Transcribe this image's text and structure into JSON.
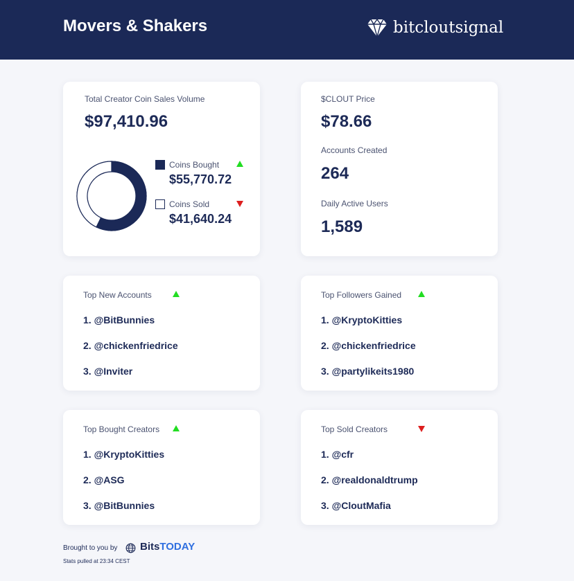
{
  "header": {
    "title": "Movers & Shakers",
    "brand_name": "bitcloutsignal",
    "brand_icon": "diamond-icon"
  },
  "sales": {
    "label": "Total Creator Coin Sales Volume",
    "total": "$97,410.96",
    "bought_label": "Coins Bought",
    "bought_value": "$55,770.72",
    "bought_trend": "up",
    "sold_label": "Coins Sold",
    "sold_value": "$41,640.24",
    "sold_trend": "down"
  },
  "chart_data": {
    "type": "pie",
    "categories": [
      "Coins Bought",
      "Coins Sold"
    ],
    "values": [
      55770.72,
      41640.24
    ],
    "colors": [
      "#1b2957",
      "#ffffff"
    ]
  },
  "stats": {
    "price_label": "$CLOUT Price",
    "price_value": "$78.66",
    "accounts_label": "Accounts Created",
    "accounts_value": "264",
    "dau_label": "Daily Active Users",
    "dau_value": "1,589"
  },
  "lists": {
    "new_accounts": {
      "title": "Top New Accounts",
      "trend": "up",
      "items": [
        "1. @BitBunnies",
        "2. @chickenfriedrice",
        "3. @Inviter"
      ]
    },
    "followers": {
      "title": "Top Followers Gained",
      "trend": "up",
      "items": [
        "1. @KryptoKitties",
        "2. @chickenfriedrice",
        "3. @partylikeits1980"
      ]
    },
    "bought": {
      "title": "Top Bought Creators",
      "trend": "up",
      "items": [
        "1. @KryptoKitties",
        "2. @ASG",
        "3. @BitBunnies"
      ]
    },
    "sold": {
      "title": "Top Sold Creators",
      "trend": "down",
      "items": [
        "1. @cfr",
        "2. @realdonaldtrump",
        "3. @CloutMafia"
      ]
    }
  },
  "footer": {
    "brought_by": "Brought to you by",
    "sponsor_a": "Bits",
    "sponsor_b": "TODAY",
    "sponsor_icon": "globe-icon",
    "stats_time": "Stats pulled at 23:34 CEST"
  },
  "colors": {
    "navy": "#1b2957",
    "up": "#22dd22",
    "down": "#dd1f1f",
    "accent_blue": "#2f6fe0"
  }
}
